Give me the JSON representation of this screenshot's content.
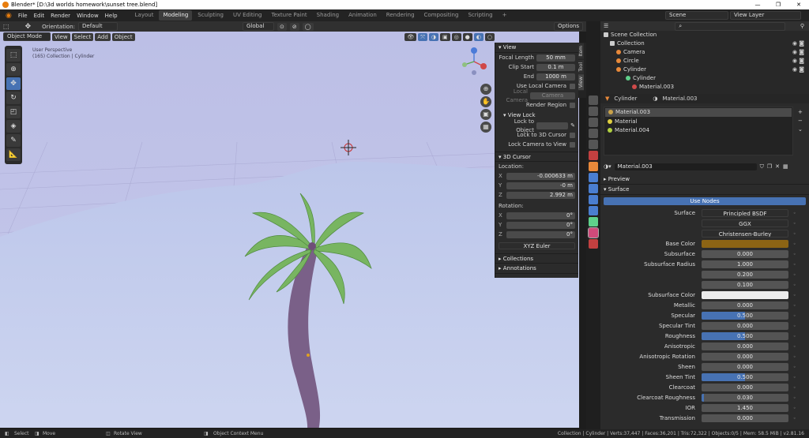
{
  "window": {
    "title": "Blender* [D:\\3d worlds homework\\sunset tree.blend]",
    "minimize": "—",
    "maximize": "❐",
    "close": "✕"
  },
  "menus": [
    "File",
    "Edit",
    "Render",
    "Window",
    "Help"
  ],
  "workspaces": [
    {
      "label": "Layout",
      "active": false
    },
    {
      "label": "Modeling",
      "active": true
    },
    {
      "label": "Sculpting",
      "active": false
    },
    {
      "label": "UV Editing",
      "active": false
    },
    {
      "label": "Texture Paint",
      "active": false
    },
    {
      "label": "Shading",
      "active": false
    },
    {
      "label": "Animation",
      "active": false
    },
    {
      "label": "Rendering",
      "active": false
    },
    {
      "label": "Compositing",
      "active": false
    },
    {
      "label": "Scripting",
      "active": false
    }
  ],
  "scene": {
    "scene_label": "Scene",
    "view_layer": "View Layer"
  },
  "viewport_header": {
    "orientation_label": "Orientation:",
    "orientation": "Default",
    "transform": "Global",
    "options": "Options",
    "mode": "Object Mode",
    "menu": [
      "View",
      "Select",
      "Add",
      "Object"
    ]
  },
  "viewport_info": {
    "line1": "User Perspective",
    "line2": "(165) Collection | Cylinder"
  },
  "npanel": {
    "tabs": [
      "Item",
      "Tool",
      "View"
    ],
    "view": {
      "title": "View",
      "focal_label": "Focal Length",
      "focal": "50 mm",
      "clip_start_label": "Clip Start",
      "clip_start": "0.1 m",
      "end_label": "End",
      "end": "1000 m",
      "use_local_camera": "Use Local Camera",
      "local_camera": "Local Camera",
      "camera": "Camera",
      "render_region": "Render Region"
    },
    "view_lock": {
      "title": "View Lock",
      "lock_to_object": "Lock to Object",
      "lock_3d_cursor": "Lock to 3D Cursor",
      "lock_camera": "Lock Camera to View"
    },
    "cursor": {
      "title": "3D Cursor",
      "location": "Location:",
      "x": "-0.000633 m",
      "y": "-0 m",
      "z": "2.992 m",
      "rotation": "Rotation:",
      "rx": "0°",
      "ry": "0°",
      "rz": "0°",
      "mode": "XYZ Euler",
      "xl": "X",
      "yl": "Y",
      "zl": "Z"
    },
    "collections": "Collections",
    "annotations": "Annotations"
  },
  "outliner": {
    "root": "Scene Collection",
    "items": [
      {
        "label": "Collection",
        "indent": 1,
        "color": "#cccccc"
      },
      {
        "label": "Camera",
        "indent": 2,
        "color": "#e8893a"
      },
      {
        "label": "Circle",
        "indent": 2,
        "color": "#e8893a"
      },
      {
        "label": "Cylinder",
        "indent": 2,
        "color": "#e8893a"
      },
      {
        "label": "Cylinder",
        "indent": 3,
        "color": "#5fd08a"
      },
      {
        "label": "Material.003",
        "indent": 4,
        "color": "#d04a4a"
      }
    ]
  },
  "material": {
    "object": "Cylinder",
    "material": "Material.003",
    "slots": [
      "Material.003",
      "Material",
      "Material.004"
    ],
    "datablock": "Material.003",
    "preview": "Preview",
    "surface_section": "Surface",
    "use_nodes": "Use Nodes"
  },
  "properties": [
    {
      "label": "Surface",
      "value": "Principled BSDF",
      "kind": "text"
    },
    {
      "label": "",
      "value": "GGX",
      "kind": "text"
    },
    {
      "label": "",
      "value": "Christensen-Burley",
      "kind": "text"
    },
    {
      "label": "Base Color",
      "value": "",
      "kind": "color",
      "color": "#8c6414"
    },
    {
      "label": "Subsurface",
      "value": "0.000",
      "kind": "num",
      "fill": 0
    },
    {
      "label": "Subsurface Radius",
      "value": "1.000",
      "kind": "num",
      "fill": 0
    },
    {
      "label": "",
      "value": "0.200",
      "kind": "num",
      "fill": 0
    },
    {
      "label": "",
      "value": "0.100",
      "kind": "num",
      "fill": 0
    },
    {
      "label": "Subsurface Color",
      "value": "",
      "kind": "color",
      "color": "#ececec"
    },
    {
      "label": "Metallic",
      "value": "0.000",
      "kind": "num",
      "fill": 0
    },
    {
      "label": "Specular",
      "value": "0.500",
      "kind": "num",
      "fill": 0.5
    },
    {
      "label": "Specular Tint",
      "value": "0.000",
      "kind": "num",
      "fill": 0
    },
    {
      "label": "Roughness",
      "value": "0.500",
      "kind": "num",
      "fill": 0.5
    },
    {
      "label": "Anisotropic",
      "value": "0.000",
      "kind": "num",
      "fill": 0
    },
    {
      "label": "Anisotropic Rotation",
      "value": "0.000",
      "kind": "num",
      "fill": 0
    },
    {
      "label": "Sheen",
      "value": "0.000",
      "kind": "num",
      "fill": 0
    },
    {
      "label": "Sheen Tint",
      "value": "0.500",
      "kind": "num",
      "fill": 0.5
    },
    {
      "label": "Clearcoat",
      "value": "0.000",
      "kind": "num",
      "fill": 0
    },
    {
      "label": "Clearcoat Roughness",
      "value": "0.030",
      "kind": "num",
      "fill": 0.03
    },
    {
      "label": "IOR",
      "value": "1.450",
      "kind": "num",
      "fill": 0
    },
    {
      "label": "Transmission",
      "value": "0.000",
      "kind": "num",
      "fill": 0
    }
  ],
  "status": {
    "select": "Select",
    "move": "Move",
    "rotate": "Rotate View",
    "context": "Object Context Menu",
    "info": "Collection | Cylinder | Verts:37,447 | Faces:36,201 | Tris:72,322 | Objects:0/5 | Mem: 58.5 MiB | v2.81.16"
  },
  "colors": {
    "accent": "#4772b3",
    "sky": "#bfc2e6",
    "ground": "#c4cdec",
    "leaves": "#74b05c",
    "trunk": "#7a6088"
  }
}
